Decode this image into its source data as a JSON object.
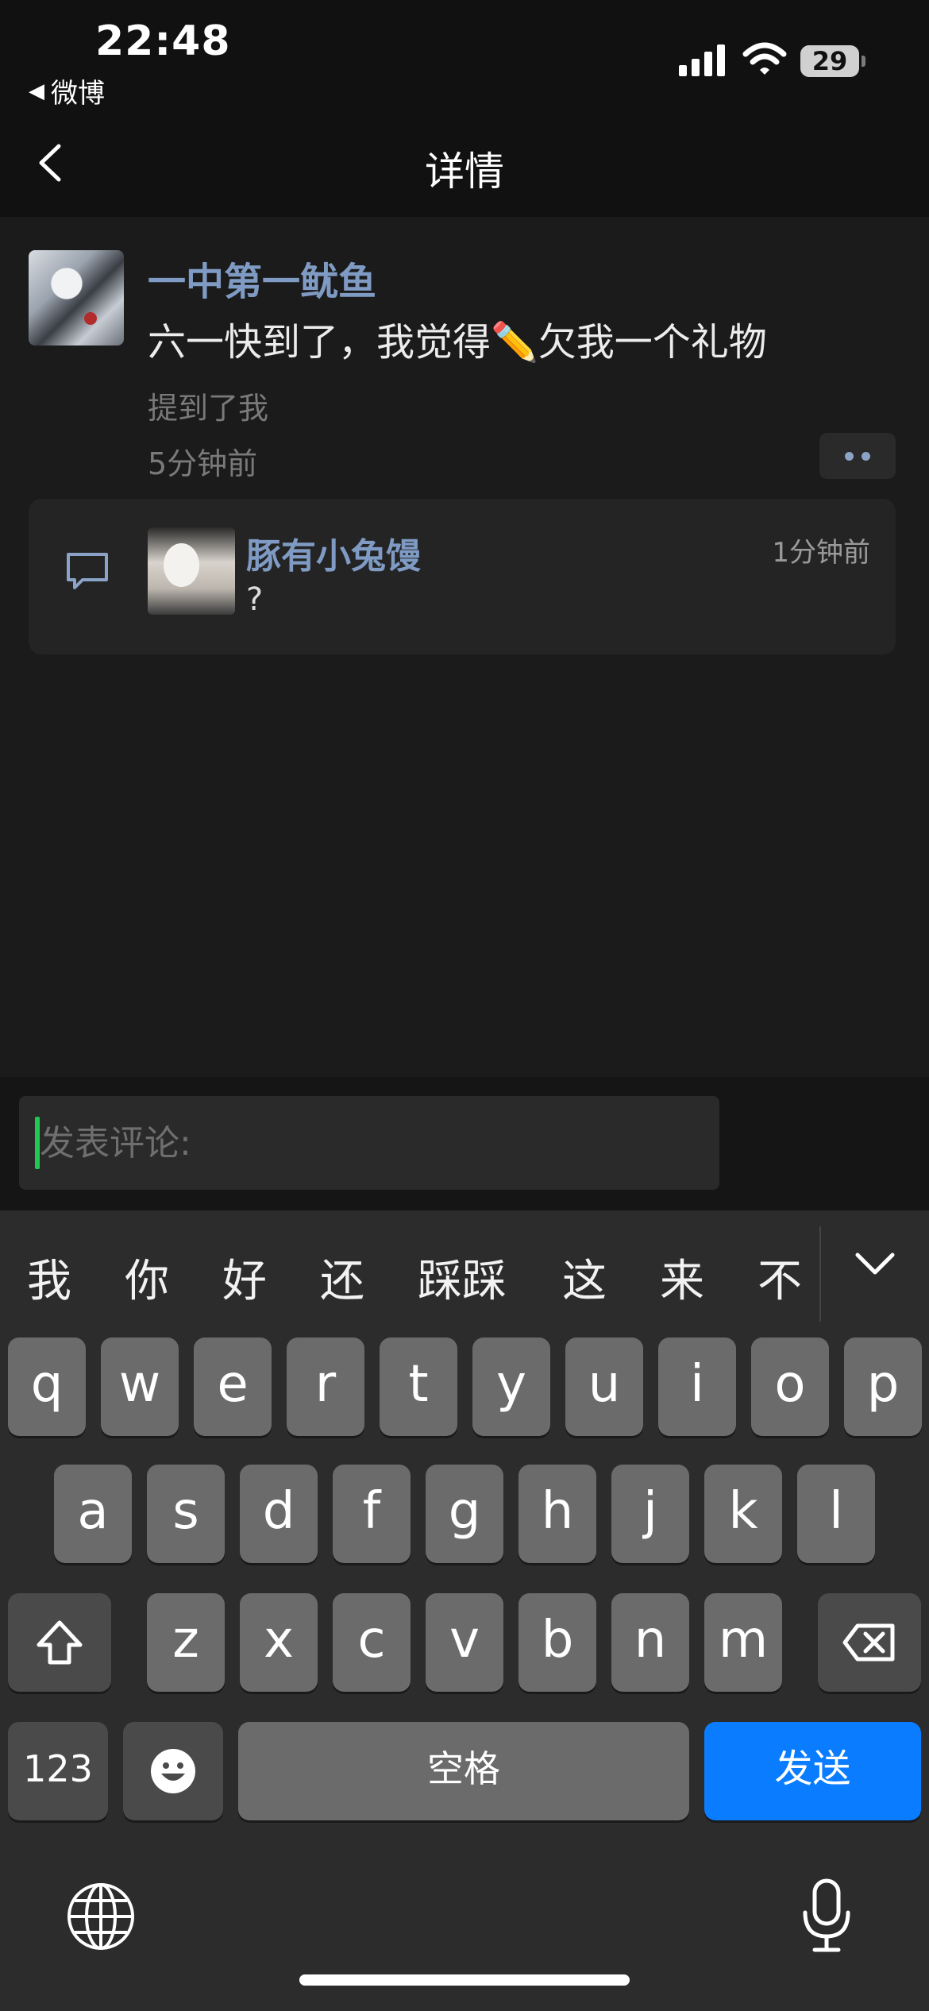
{
  "status_bar": {
    "time": "22:48",
    "back_app": "微博",
    "battery": "29"
  },
  "nav": {
    "title": "详情"
  },
  "post": {
    "author": "一中第一鱿鱼",
    "text": "六一快到了，我觉得✏️欠我一个礼物",
    "mention": "提到了我",
    "time": "5分钟前"
  },
  "reply": {
    "author": "豚有小兔馒",
    "time": "1分钟前",
    "text": "?"
  },
  "comment_input": {
    "placeholder": "发表评论:"
  },
  "keyboard": {
    "candidates": [
      "我",
      "你",
      "好",
      "还",
      "踩踩",
      "这",
      "来",
      "不"
    ],
    "row1": [
      "q",
      "w",
      "e",
      "r",
      "t",
      "y",
      "u",
      "i",
      "o",
      "p"
    ],
    "row2": [
      "a",
      "s",
      "d",
      "f",
      "g",
      "h",
      "j",
      "k",
      "l"
    ],
    "row3": [
      "z",
      "x",
      "c",
      "v",
      "b",
      "n",
      "m"
    ],
    "numbers_label": "123",
    "space_label": "空格",
    "send_label": "发送"
  },
  "colors": {
    "accent_blue": "#0a7cff",
    "name_blue": "#7f9bc4",
    "caret_green": "#1fc94f"
  },
  "icons": [
    "back-arrow-icon",
    "signal-icon",
    "wifi-icon",
    "battery-icon",
    "more-dots-icon",
    "comment-bubble-icon",
    "collapse-chevron-icon",
    "shift-icon",
    "delete-icon",
    "emoji-icon",
    "globe-icon",
    "microphone-icon"
  ]
}
